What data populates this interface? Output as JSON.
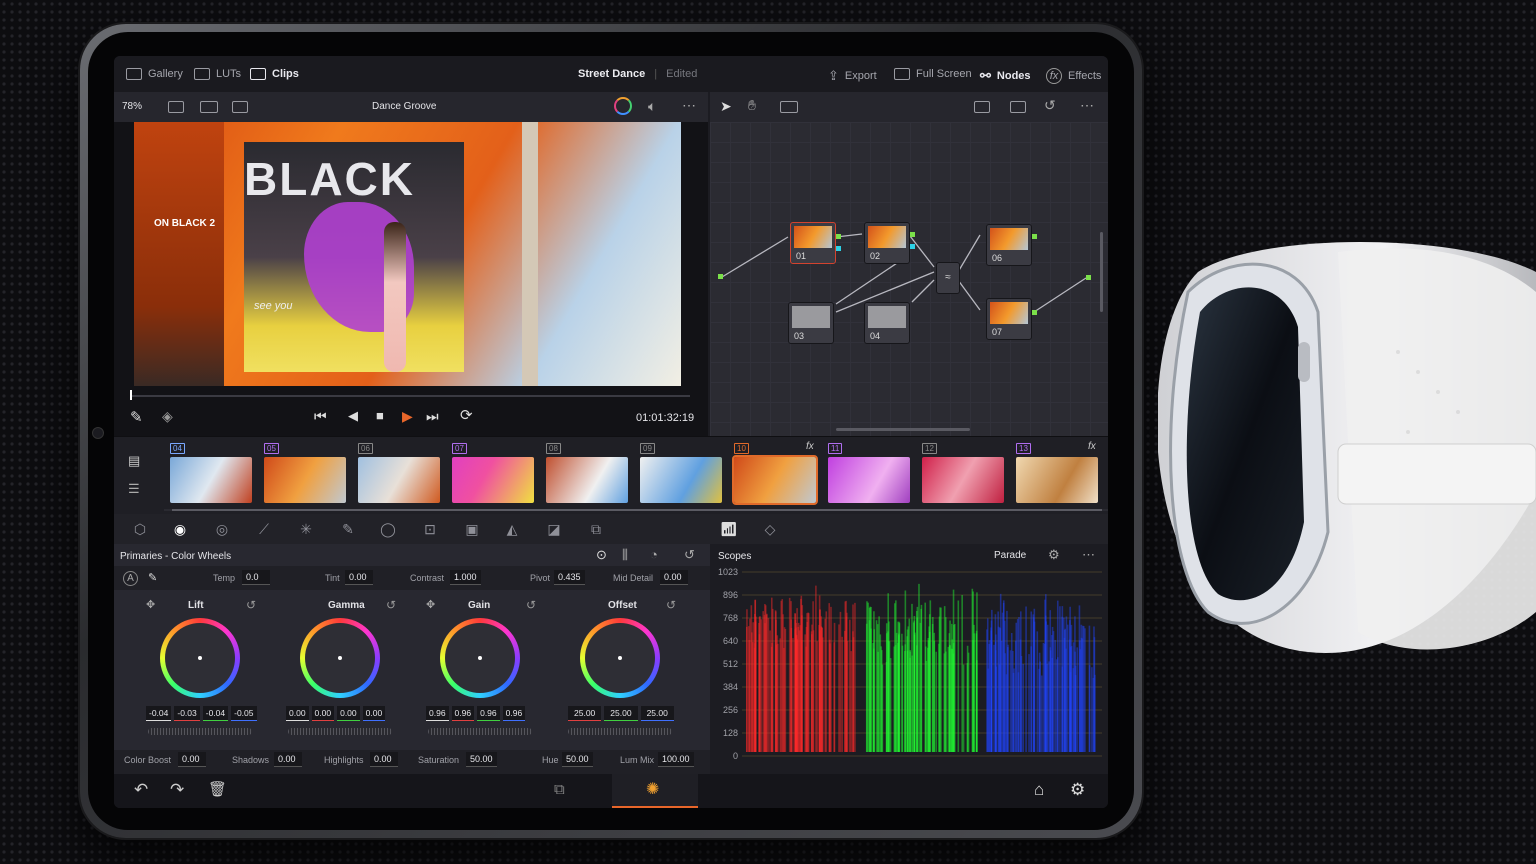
{
  "topbar": {
    "gallery": "Gallery",
    "luts": "LUTs",
    "clips": "Clips",
    "project_title": "Street Dance",
    "project_status": "Edited",
    "export": "Export",
    "full_screen": "Full Screen",
    "nodes": "Nodes",
    "effects": "Effects"
  },
  "viewer": {
    "zoom": "78%",
    "clip_name": "Dance Groove",
    "timecode": "01:01:32:19"
  },
  "video_text": {
    "black": "BLACK",
    "black2": "ON BLACK 2",
    "see_you": "see you"
  },
  "nodes": [
    {
      "label": "01"
    },
    {
      "label": "02"
    },
    {
      "label": "03"
    },
    {
      "label": "04"
    },
    {
      "label": "06"
    },
    {
      "label": "07"
    }
  ],
  "clips": [
    {
      "num": "04",
      "color": "#7aa8ff",
      "fx": ""
    },
    {
      "num": "05",
      "color": "#b06ef0",
      "fx": ""
    },
    {
      "num": "06",
      "color": "#888888",
      "fx": ""
    },
    {
      "num": "07",
      "color": "#b06ef0",
      "fx": ""
    },
    {
      "num": "08",
      "color": "#888888",
      "fx": ""
    },
    {
      "num": "09",
      "color": "#888888",
      "fx": ""
    },
    {
      "num": "10",
      "color": "#e06a2a",
      "fx": "fx"
    },
    {
      "num": "11",
      "color": "#b06ef0",
      "fx": ""
    },
    {
      "num": "12",
      "color": "#888888",
      "fx": ""
    },
    {
      "num": "13",
      "color": "#b06ef0",
      "fx": "fx"
    }
  ],
  "primaries": {
    "title": "Primaries - Color Wheels",
    "temp_label": "Temp",
    "temp": "0.0",
    "tint_label": "Tint",
    "tint": "0.00",
    "contrast_label": "Contrast",
    "contrast": "1.000",
    "pivot_label": "Pivot",
    "pivot": "0.435",
    "middetail_label": "Mid Detail",
    "middetail": "0.00",
    "wheels": [
      {
        "name": "Lift",
        "values": [
          "-0.04",
          "-0.03",
          "-0.04",
          "-0.05"
        ]
      },
      {
        "name": "Gamma",
        "values": [
          "0.00",
          "0.00",
          "0.00",
          "0.00"
        ]
      },
      {
        "name": "Gain",
        "values": [
          "0.96",
          "0.96",
          "0.96",
          "0.96"
        ]
      },
      {
        "name": "Offset",
        "values": [
          "25.00",
          "25.00",
          "25.00"
        ]
      }
    ],
    "colorboost_label": "Color Boost",
    "colorboost": "0.00",
    "shadows_label": "Shadows",
    "shadows": "0.00",
    "highlights_label": "Highlights",
    "highlights": "0.00",
    "saturation_label": "Saturation",
    "saturation": "50.00",
    "hue_label": "Hue",
    "hue": "50.00",
    "lummix_label": "Lum Mix",
    "lummix": "100.00"
  },
  "scopes": {
    "title": "Scopes",
    "mode": "Parade",
    "ticks": [
      "1023",
      "896",
      "768",
      "640",
      "512",
      "384",
      "256",
      "128",
      "0"
    ]
  },
  "colors": {
    "accent": "#e8662a",
    "node_green": "#7be04a",
    "node_cyan": "#2dd1e6"
  }
}
